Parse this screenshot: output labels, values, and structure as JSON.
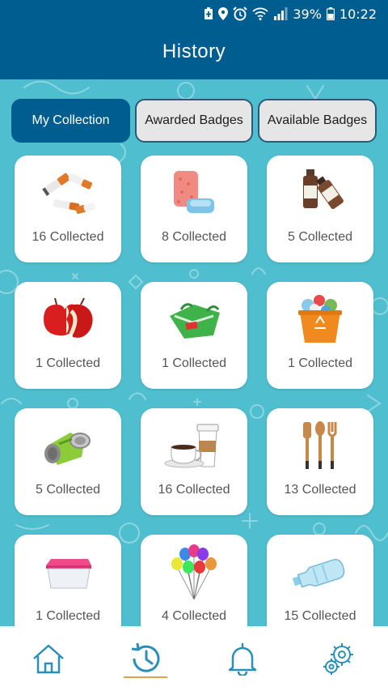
{
  "status_bar": {
    "battery_percent": "39%",
    "time": "10:22",
    "icons": [
      "battery-saver-icon",
      "location-icon",
      "alarm-icon",
      "wifi-icon",
      "signal-icon",
      "battery-icon"
    ]
  },
  "header": {
    "title": "History"
  },
  "tabs": [
    {
      "label": "My Collection",
      "active": true
    },
    {
      "label": "Awarded Badges",
      "active": false
    },
    {
      "label": "Available Badges",
      "active": false
    }
  ],
  "items": [
    {
      "icon": "cigarette-butts-icon",
      "count_label": "16 Collected"
    },
    {
      "icon": "sponge-soap-icon",
      "count_label": "8 Collected"
    },
    {
      "icon": "medicine-bottles-icon",
      "count_label": "5 Collected"
    },
    {
      "icon": "apple-core-icon",
      "count_label": "1 Collected"
    },
    {
      "icon": "plastic-bag-icon",
      "count_label": "1 Collected"
    },
    {
      "icon": "recycling-bin-icon",
      "count_label": "1 Collected"
    },
    {
      "icon": "crushed-can-icon",
      "count_label": "5 Collected"
    },
    {
      "icon": "coffee-cups-icon",
      "count_label": "16 Collected"
    },
    {
      "icon": "kitchen-utensils-icon",
      "count_label": "13 Collected"
    },
    {
      "icon": "food-container-icon",
      "count_label": "1 Collected"
    },
    {
      "icon": "balloons-icon",
      "count_label": "4 Collected"
    },
    {
      "icon": "plastic-bottle-icon",
      "count_label": "15 Collected"
    }
  ],
  "bottom_nav": [
    {
      "icon": "home-icon",
      "active": false
    },
    {
      "icon": "history-icon",
      "active": true
    },
    {
      "icon": "bell-icon",
      "active": false
    },
    {
      "icon": "settings-icon",
      "active": false
    }
  ],
  "colors": {
    "primary": "#005d8f",
    "background": "#4fbfcf",
    "nav_icon": "#2a8fb8",
    "active_indicator": "#e0a24a"
  }
}
